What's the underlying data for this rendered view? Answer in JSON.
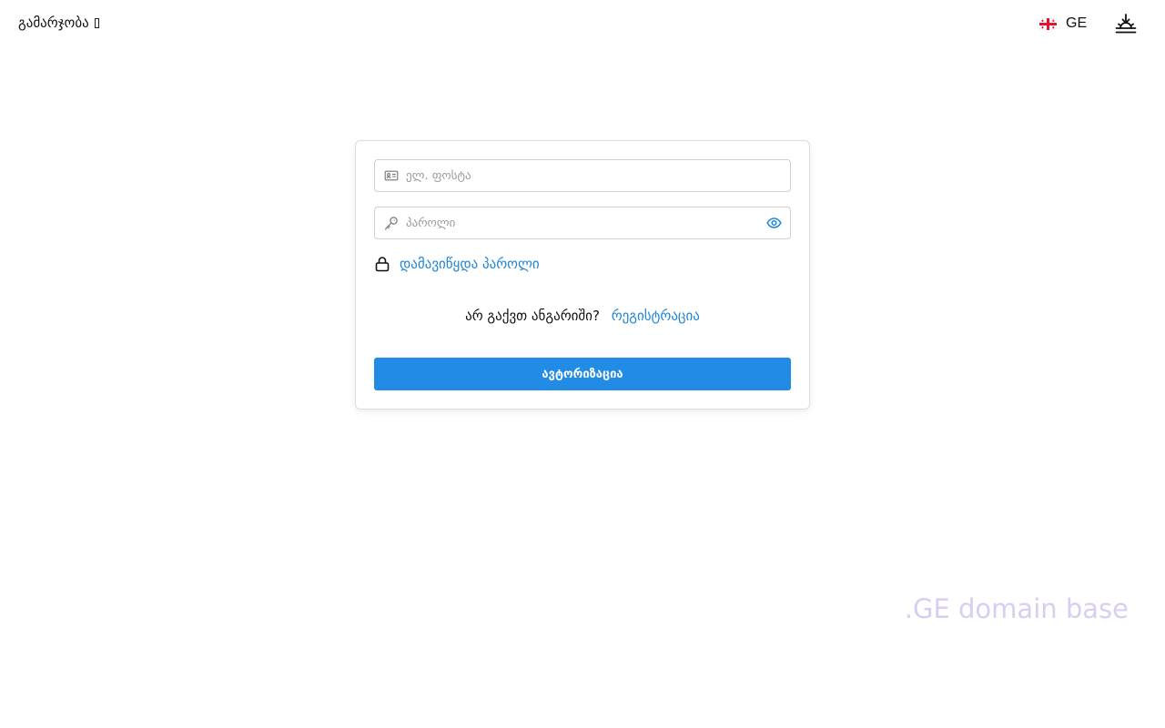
{
  "header": {
    "greeting": "გამარჯობა",
    "language_code": "GE",
    "icons": {
      "flag": "georgia-flag-icon",
      "action": "sunset-download-icon"
    }
  },
  "login_form": {
    "email_placeholder": "ელ. ფოსტა",
    "email_value": "",
    "password_placeholder": "პაროლი",
    "password_value": "",
    "forgot_password_label": "დამავიწყდა პაროლი",
    "no_account_text": "არ გაქვთ ანგარიში?",
    "register_label": "რეგისტრაცია",
    "submit_label": "ავტორიზაცია",
    "icons": {
      "email": "id-card-icon",
      "password": "key-icon",
      "toggle": "eye-icon",
      "forgot": "lock-icon"
    }
  },
  "watermark": ".GE domain base",
  "colors": {
    "accent": "#228be6",
    "link": "#1e84d6",
    "watermark": "#d9cdf0",
    "border": "#cfcfcf"
  }
}
